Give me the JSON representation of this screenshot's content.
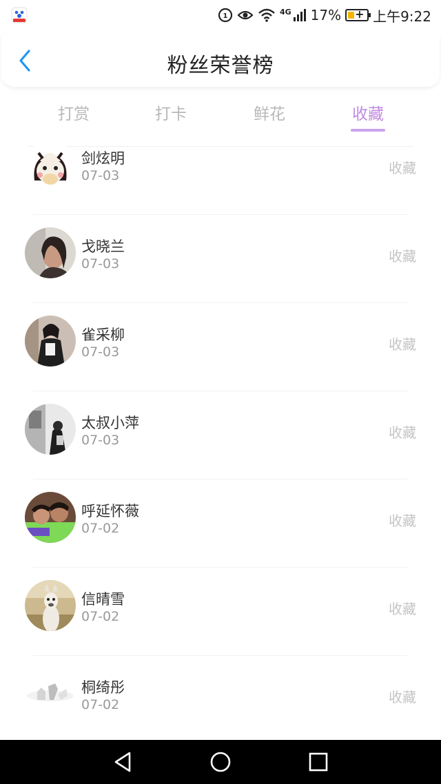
{
  "status_bar": {
    "battery_percent": "17%",
    "time": "上午9:22",
    "network": "4G"
  },
  "header": {
    "title": "粉丝荣誉榜"
  },
  "tabs": [
    {
      "label": "打赏",
      "active": false
    },
    {
      "label": "打卡",
      "active": false
    },
    {
      "label": "鲜花",
      "active": false
    },
    {
      "label": "收藏",
      "active": true
    }
  ],
  "list": [
    {
      "name": "剑炫明",
      "date": "07-03",
      "action": "收藏",
      "avatar": "cartoon-character"
    },
    {
      "name": "戈晓兰",
      "date": "07-03",
      "action": "收藏",
      "avatar": "person-photo"
    },
    {
      "name": "雀采柳",
      "date": "07-03",
      "action": "收藏",
      "avatar": "person-photo"
    },
    {
      "name": "太叔小萍",
      "date": "07-03",
      "action": "收藏",
      "avatar": "person-photo"
    },
    {
      "name": "呼延怀薇",
      "date": "07-02",
      "action": "收藏",
      "avatar": "person-photo"
    },
    {
      "name": "信晴雪",
      "date": "07-02",
      "action": "收藏",
      "avatar": "alpaca-photo"
    },
    {
      "name": "桐绮彤",
      "date": "07-02",
      "action": "收藏",
      "avatar": "sketch-image"
    }
  ],
  "colors": {
    "accent": "#c08be0",
    "back_arrow": "#2196f3",
    "muted": "#c4c4c4"
  }
}
